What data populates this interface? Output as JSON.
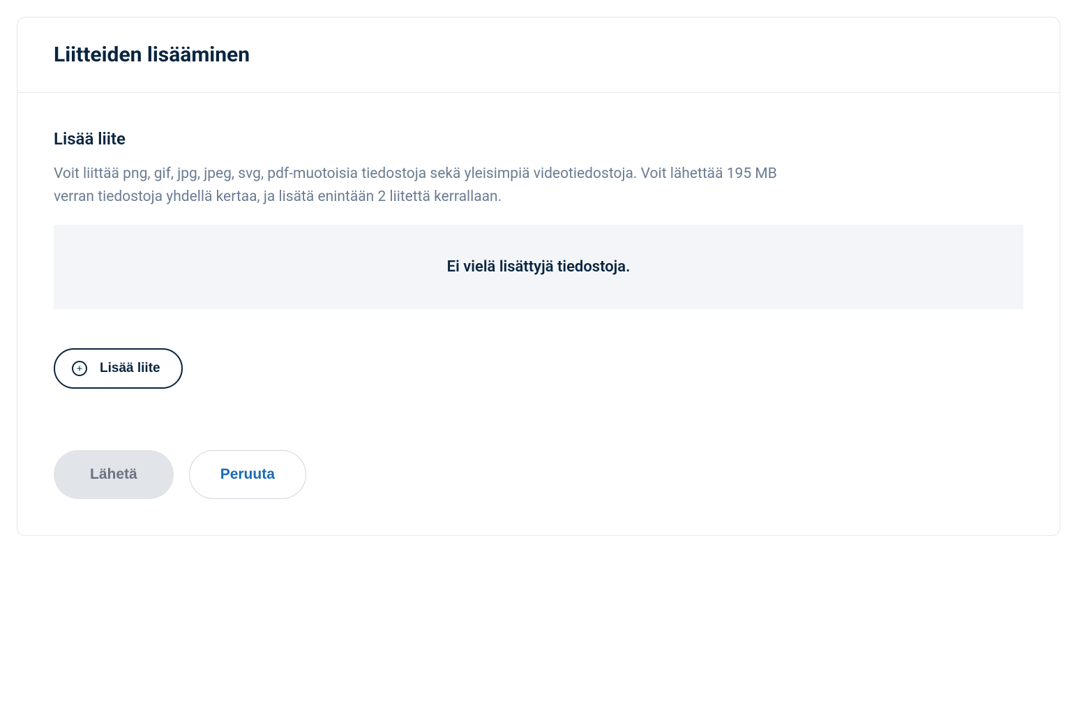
{
  "card": {
    "title": "Liitteiden lisääminen"
  },
  "section": {
    "title": "Lisää liite",
    "description": "Voit liittää png, gif, jpg, jpeg, svg, pdf-muotoisia tiedostoja sekä yleisimpiä videotiedostoja. Voit lähettää 195 MB verran tiedostoja yhdellä kertaa, ja lisätä enintään 2 liitettä kerrallaan.",
    "empty_message": "Ei vielä lisättyjä tiedostoja.",
    "add_button_label": "Lisää liite"
  },
  "footer": {
    "submit_label": "Lähetä",
    "cancel_label": "Peruuta"
  }
}
